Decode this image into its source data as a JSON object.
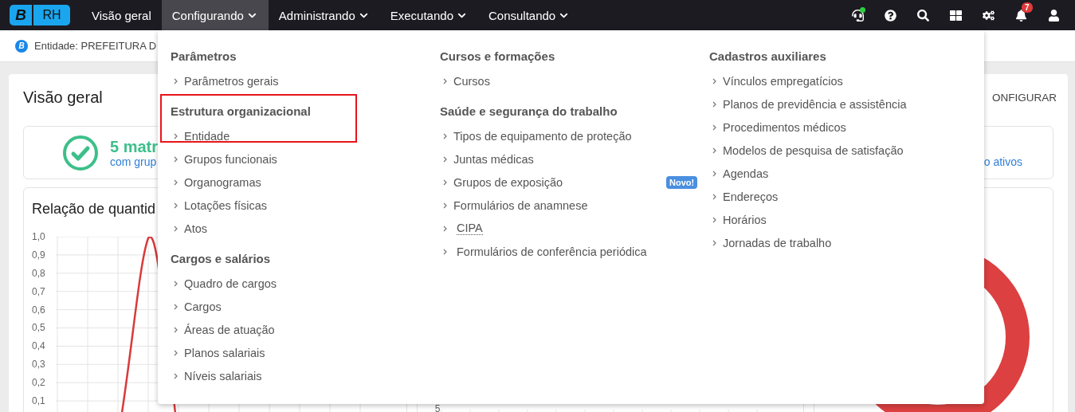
{
  "nav": {
    "logo_letter": "B",
    "logo_text": "RH",
    "items": [
      {
        "label": "Visão geral",
        "dropdown": false,
        "selected": false
      },
      {
        "label": "Configurando",
        "dropdown": true,
        "selected": true
      },
      {
        "label": "Administrando",
        "dropdown": true,
        "selected": false
      },
      {
        "label": "Executando",
        "dropdown": true,
        "selected": false
      },
      {
        "label": "Consultando",
        "dropdown": true,
        "selected": false
      }
    ],
    "icons": [
      {
        "kind": "headset",
        "online": true
      },
      {
        "kind": "help"
      },
      {
        "kind": "search"
      },
      {
        "kind": "grid"
      },
      {
        "kind": "settings"
      },
      {
        "kind": "bell",
        "badge": "7"
      },
      {
        "kind": "user"
      }
    ]
  },
  "entity_bar": {
    "letter": "B",
    "text": "Entidade: PREFEITURA D"
  },
  "page": {
    "title": "Visão geral",
    "action": "ONFIGURAR",
    "summary": {
      "count": "5 matr",
      "subtitle": "com grup",
      "right_link": "o ativos"
    },
    "chart": {
      "title": "Relação de quantid",
      "yticks": [
        "1,0",
        "0,9",
        "0,8",
        "0,7",
        "0,6",
        "0,5",
        "0,4",
        "0,3",
        "0,2",
        "0,1"
      ]
    },
    "middle_chart": {
      "tick": "5"
    }
  },
  "menu": {
    "columns": [
      [
        {
          "title": "Parâmetros",
          "highlighted": false,
          "items": [
            {
              "label": "Parâmetros gerais",
              "kind": "plain"
            }
          ]
        },
        {
          "title": "Estrutura organizacional",
          "highlighted": true,
          "items": [
            {
              "label": "Entidade",
              "kind": "plain"
            },
            {
              "label": "Grupos funcionais",
              "kind": "plain"
            },
            {
              "label": "Organogramas",
              "kind": "plain"
            },
            {
              "label": "Lotações físicas",
              "kind": "plain"
            },
            {
              "label": "Atos",
              "kind": "plain"
            }
          ]
        },
        {
          "title": "Cargos e salários",
          "highlighted": false,
          "items": [
            {
              "label": "Quadro de cargos",
              "kind": "plain"
            },
            {
              "label": "Cargos",
              "kind": "plain"
            },
            {
              "label": "Áreas de atuação",
              "kind": "plain"
            },
            {
              "label": "Planos salariais",
              "kind": "plain"
            },
            {
              "label": "Níveis salariais",
              "kind": "plain"
            }
          ]
        }
      ],
      [
        {
          "title": "Cursos e formações",
          "highlighted": false,
          "items": [
            {
              "label": "Cursos",
              "kind": "plain"
            }
          ]
        },
        {
          "title": "Saúde e segurança do trabalho",
          "highlighted": false,
          "items": [
            {
              "label": "Tipos de equipamento de proteção",
              "kind": "plain"
            },
            {
              "label": "Juntas médicas",
              "kind": "plain"
            },
            {
              "label": "Grupos de exposição",
              "kind": "plain",
              "badge": "Novo!"
            },
            {
              "label": "Formulários de anamnese",
              "kind": "plain"
            },
            {
              "label": "CIPA",
              "kind": "abbr"
            },
            {
              "label": "Formulários de conferência periódica",
              "kind": "indented"
            }
          ]
        }
      ],
      [
        {
          "title": "Cadastros auxiliares",
          "highlighted": false,
          "items": [
            {
              "label": "Vínculos empregatícios",
              "kind": "plain"
            },
            {
              "label": "Planos de previdência e assistência",
              "kind": "plain"
            },
            {
              "label": "Procedimentos médicos",
              "kind": "plain"
            },
            {
              "label": "Modelos de pesquisa de satisfação",
              "kind": "plain"
            },
            {
              "label": "Agendas",
              "kind": "plain"
            },
            {
              "label": "Endereços",
              "kind": "plain"
            },
            {
              "label": "Horários",
              "kind": "plain"
            },
            {
              "label": "Jornadas de trabalho",
              "kind": "plain"
            }
          ]
        }
      ]
    ]
  }
}
